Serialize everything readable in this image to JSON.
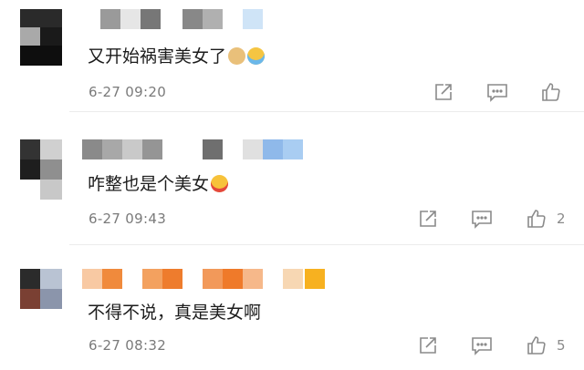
{
  "comments": [
    {
      "text": "又开始祸害美女了",
      "emojis": [
        "doge-emoji",
        "laughing-crying-emoji"
      ],
      "time": "6-27 09:20",
      "like_count": ""
    },
    {
      "text": "咋整也是个美女",
      "emojis": [
        "heart-eyes-emoji"
      ],
      "time": "6-27 09:43",
      "like_count": "2"
    },
    {
      "text": "不得不说，真是美女啊",
      "emojis": [],
      "time": "6-27 08:32",
      "like_count": "5"
    }
  ],
  "icons": {
    "share": "share-icon",
    "comment": "comment-icon",
    "like": "thumbs-up-icon"
  },
  "colors": {
    "text": "#1c1c1c",
    "meta": "#7a7a7a",
    "icon": "#8a8a8a",
    "divider": "#ececec"
  }
}
